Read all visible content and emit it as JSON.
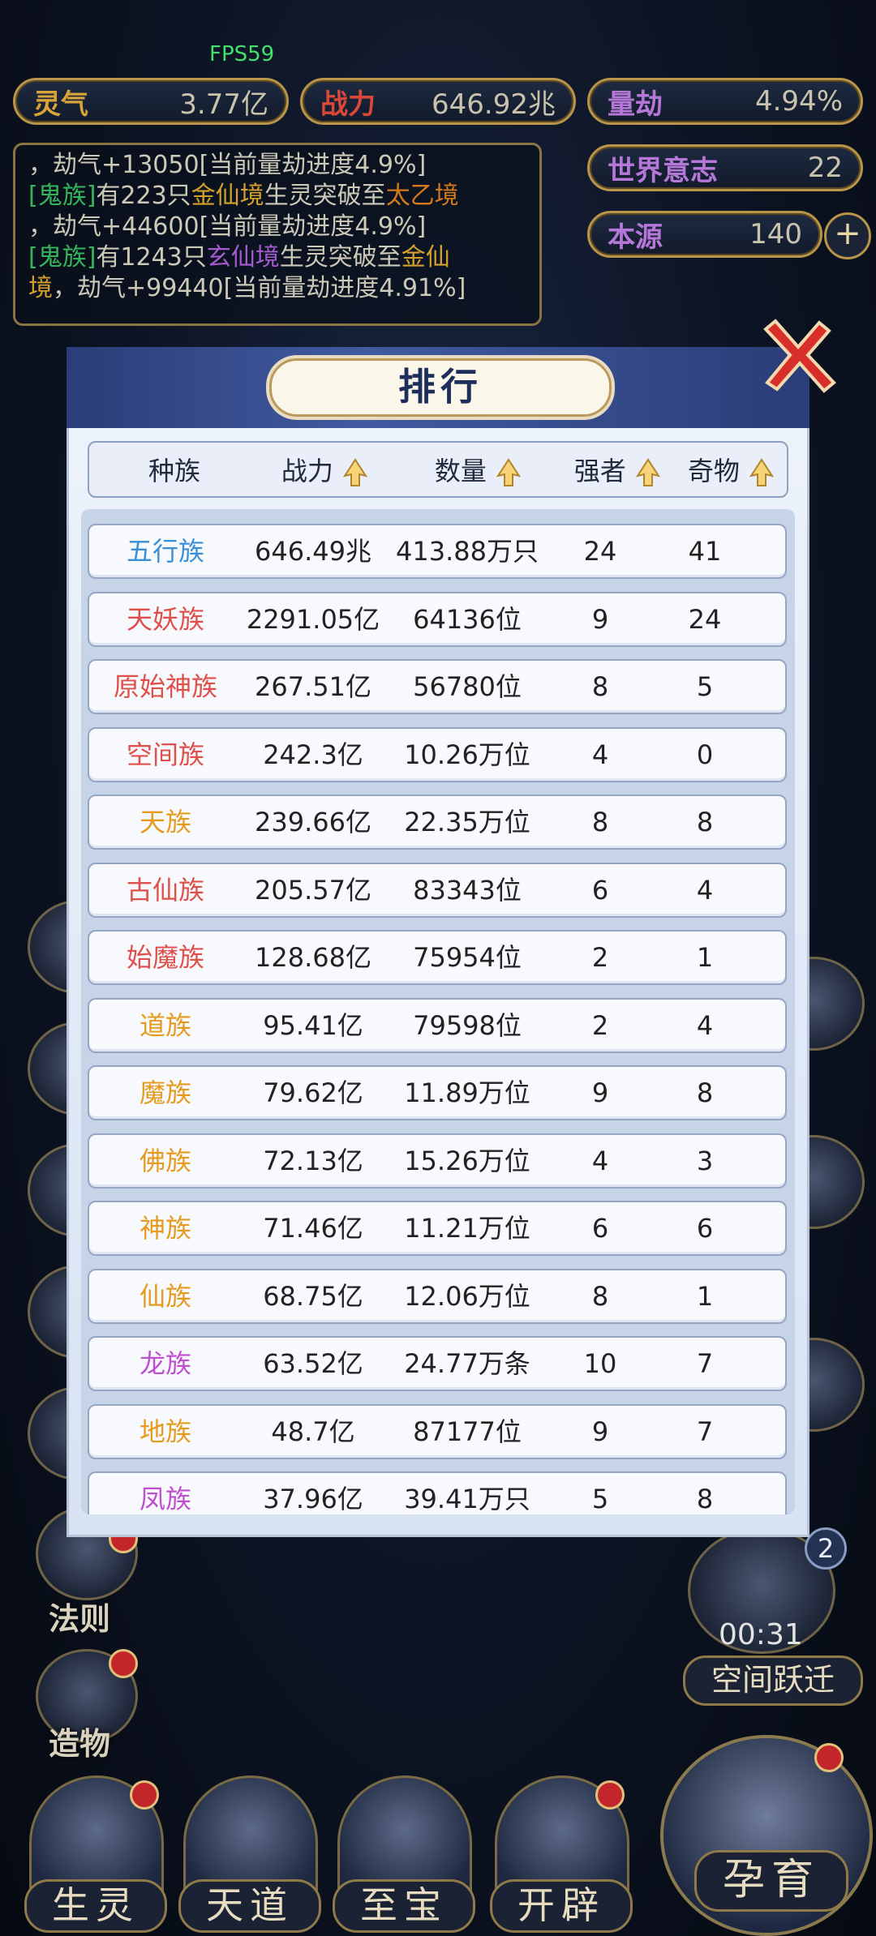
{
  "hud": {
    "fps": "FPS59",
    "lingqi": {
      "label": "灵气",
      "value": "3.77亿"
    },
    "zhanli": {
      "label": "战力",
      "value": "646.92兆"
    },
    "liangjie": {
      "label": "量劫",
      "value": "4.94%"
    },
    "shijie": {
      "label": "世界意志",
      "value": "22"
    },
    "benyuan": {
      "label": "本源",
      "value": "140"
    },
    "plus": "+"
  },
  "log": {
    "line1": "，劫气+13050[当前量劫进度4.9%]",
    "entry2": {
      "tag": "[鬼族]",
      "a": "有223只",
      "s1": "金仙境",
      "b": "生灵突破至",
      "s2": "太乙境"
    },
    "line2b": "，劫气+44600[当前量劫进度4.9%]",
    "entry3": {
      "tag": "[鬼族]",
      "a": "有1243只",
      "s1": "玄仙境",
      "b": "生灵突破至",
      "s2": "金仙"
    },
    "line3b_stage": "境",
    "line3b": "，劫气+99440[当前量劫进度4.91%]"
  },
  "sides": {
    "fa_ze": "法则",
    "zao_wu": "造物",
    "timer": "00:31",
    "kongjian": "空间跃迁",
    "badge": "2"
  },
  "nav": {
    "shengling": "生灵",
    "tiandao": "天道",
    "zhibao": "至宝",
    "kaipi": "开辟",
    "yunyu": "孕育"
  },
  "modal": {
    "title": "排行",
    "headers": {
      "race": "种族",
      "power": "战力",
      "count": "数量",
      "strong": "强者",
      "item": "奇物"
    },
    "colors": {
      "blue": "#3a8fd6",
      "red": "#e0504a",
      "orange": "#e69b1e",
      "purple": "#c04fd0"
    },
    "rows": [
      {
        "race": "五行族",
        "power": "646.49兆",
        "count": "413.88万只",
        "strong": "24",
        "item": "41",
        "color": "#3a8fd6"
      },
      {
        "race": "天妖族",
        "power": "2291.05亿",
        "count": "64136位",
        "strong": "9",
        "item": "24",
        "color": "#e0504a"
      },
      {
        "race": "原始神族",
        "power": "267.51亿",
        "count": "56780位",
        "strong": "8",
        "item": "5",
        "color": "#e0504a"
      },
      {
        "race": "空间族",
        "power": "242.3亿",
        "count": "10.26万位",
        "strong": "4",
        "item": "0",
        "color": "#e0504a"
      },
      {
        "race": "天族",
        "power": "239.66亿",
        "count": "22.35万位",
        "strong": "8",
        "item": "8",
        "color": "#e69b1e"
      },
      {
        "race": "古仙族",
        "power": "205.57亿",
        "count": "83343位",
        "strong": "6",
        "item": "4",
        "color": "#e0504a"
      },
      {
        "race": "始魔族",
        "power": "128.68亿",
        "count": "75954位",
        "strong": "2",
        "item": "1",
        "color": "#e0504a"
      },
      {
        "race": "道族",
        "power": "95.41亿",
        "count": "79598位",
        "strong": "2",
        "item": "4",
        "color": "#e69b1e"
      },
      {
        "race": "魔族",
        "power": "79.62亿",
        "count": "11.89万位",
        "strong": "9",
        "item": "8",
        "color": "#e69b1e"
      },
      {
        "race": "佛族",
        "power": "72.13亿",
        "count": "15.26万位",
        "strong": "4",
        "item": "3",
        "color": "#e69b1e"
      },
      {
        "race": "神族",
        "power": "71.46亿",
        "count": "11.21万位",
        "strong": "6",
        "item": "6",
        "color": "#e69b1e"
      },
      {
        "race": "仙族",
        "power": "68.75亿",
        "count": "12.06万位",
        "strong": "8",
        "item": "1",
        "color": "#e69b1e"
      },
      {
        "race": "龙族",
        "power": "63.52亿",
        "count": "24.77万条",
        "strong": "10",
        "item": "7",
        "color": "#c04fd0"
      },
      {
        "race": "地族",
        "power": "48.7亿",
        "count": "87177位",
        "strong": "9",
        "item": "7",
        "color": "#e69b1e"
      },
      {
        "race": "凤族",
        "power": "37.96亿",
        "count": "39.41万只",
        "strong": "5",
        "item": "8",
        "color": "#c04fd0"
      }
    ]
  }
}
